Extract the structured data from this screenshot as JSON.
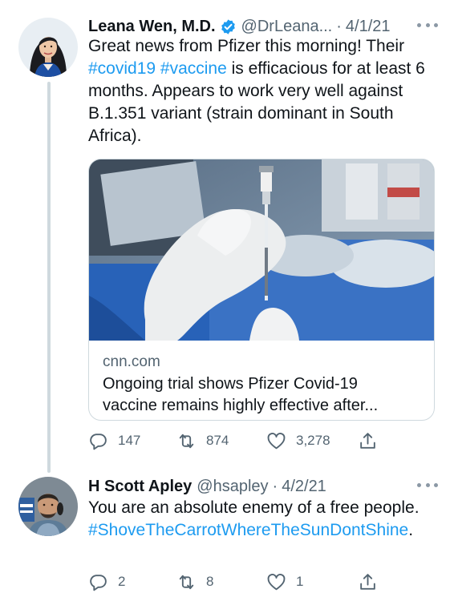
{
  "thread": {
    "original": {
      "author_name": "Leana Wen, M.D.",
      "verified": true,
      "handle": "@DrLeana...",
      "separator": "·",
      "date": "4/1/21",
      "text_segments": [
        "Great news from Pfizer this morning! Their ",
        "#covid19",
        " ",
        "#vaccine",
        " is efficacious for at least 6 months. Appears to work very well against B.1.351 variant (strain dominant in South Africa)."
      ],
      "card": {
        "domain": "cnn.com",
        "title_lines": [
          "Ongoing trial shows Pfizer Covid-19",
          "vaccine remains highly effective after..."
        ]
      },
      "replies": "147",
      "retweets": "874",
      "likes": "3,278"
    },
    "reply": {
      "author_name": "H Scott Apley",
      "handle": "@hsapley",
      "separator": "·",
      "date": "4/2/21",
      "text_segments": [
        "You are an absolute enemy of a free people. ",
        "#ShoveTheCarrotWhereTheSunDontShine",
        "."
      ],
      "replies": "2",
      "retweets": "8",
      "likes": "1"
    }
  },
  "colors": {
    "accent": "#1d9bf0",
    "text_primary": "#0f1419",
    "text_secondary": "#536471",
    "border": "#cfd9de"
  },
  "icons": {
    "reply": "reply-bubble-icon",
    "retweet": "retweet-arrows-icon",
    "like": "heart-icon",
    "share": "share-upload-icon",
    "more": "more-dots-icon",
    "verified": "verified-badge-icon"
  }
}
